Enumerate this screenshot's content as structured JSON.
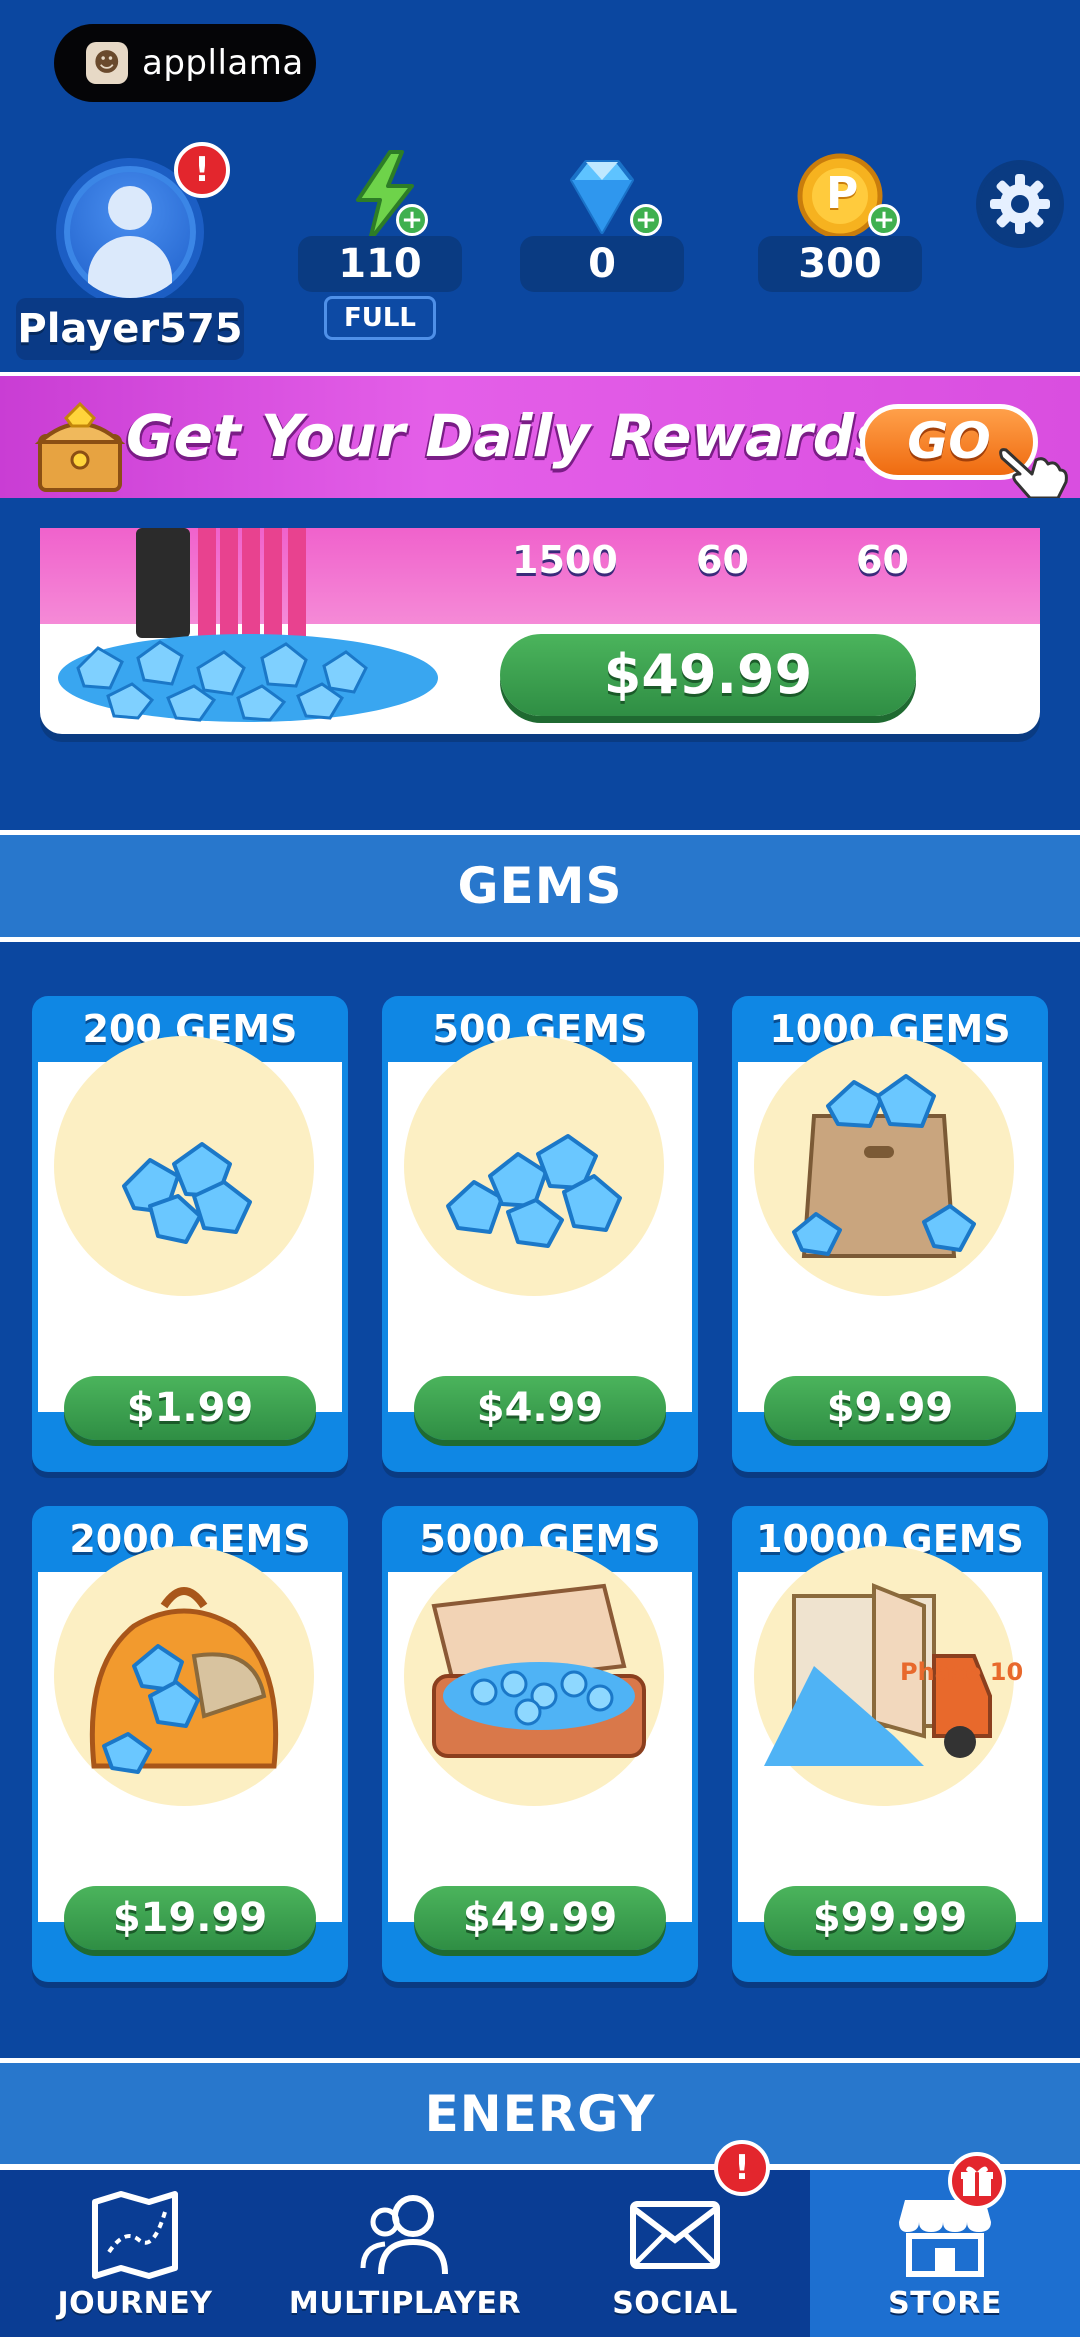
{
  "overlay": {
    "brand": "appllama"
  },
  "profile": {
    "name": "Player575",
    "alert": "!"
  },
  "resources": {
    "energy": {
      "value": "110",
      "status": "FULL",
      "icon": "lightning-icon"
    },
    "gems": {
      "value": "0",
      "icon": "gem-icon"
    },
    "coins": {
      "value": "300",
      "icon": "coin-icon",
      "coin_letter": "P"
    },
    "plus": "+"
  },
  "banner": {
    "title": "Get Your Daily Rewards",
    "button": "GO"
  },
  "featured_offer": {
    "counts": [
      "1500",
      "60",
      "60"
    ],
    "price": "$49.99"
  },
  "sections": {
    "gems": "GEMS",
    "energy": "ENERGY"
  },
  "gem_packs": [
    {
      "title": "200 GEMS",
      "price": "$1.99"
    },
    {
      "title": "500 GEMS",
      "price": "$4.99"
    },
    {
      "title": "1000 GEMS",
      "price": "$9.99"
    },
    {
      "title": "2000 GEMS",
      "price": "$19.99"
    },
    {
      "title": "5000 GEMS",
      "price": "$49.99"
    },
    {
      "title": "10000 GEMS",
      "price": "$99.99"
    }
  ],
  "truck_text": "Phase 10",
  "nav": {
    "journey": "JOURNEY",
    "multiplayer": "MULTIPLAYER",
    "social": "SOCIAL",
    "store": "STORE",
    "social_alert": "!"
  },
  "colors": {
    "background": "#0b47a0",
    "price_green": "#3aa04f",
    "banner_pink": "#d94ee0",
    "alert_red": "#e3262d"
  }
}
